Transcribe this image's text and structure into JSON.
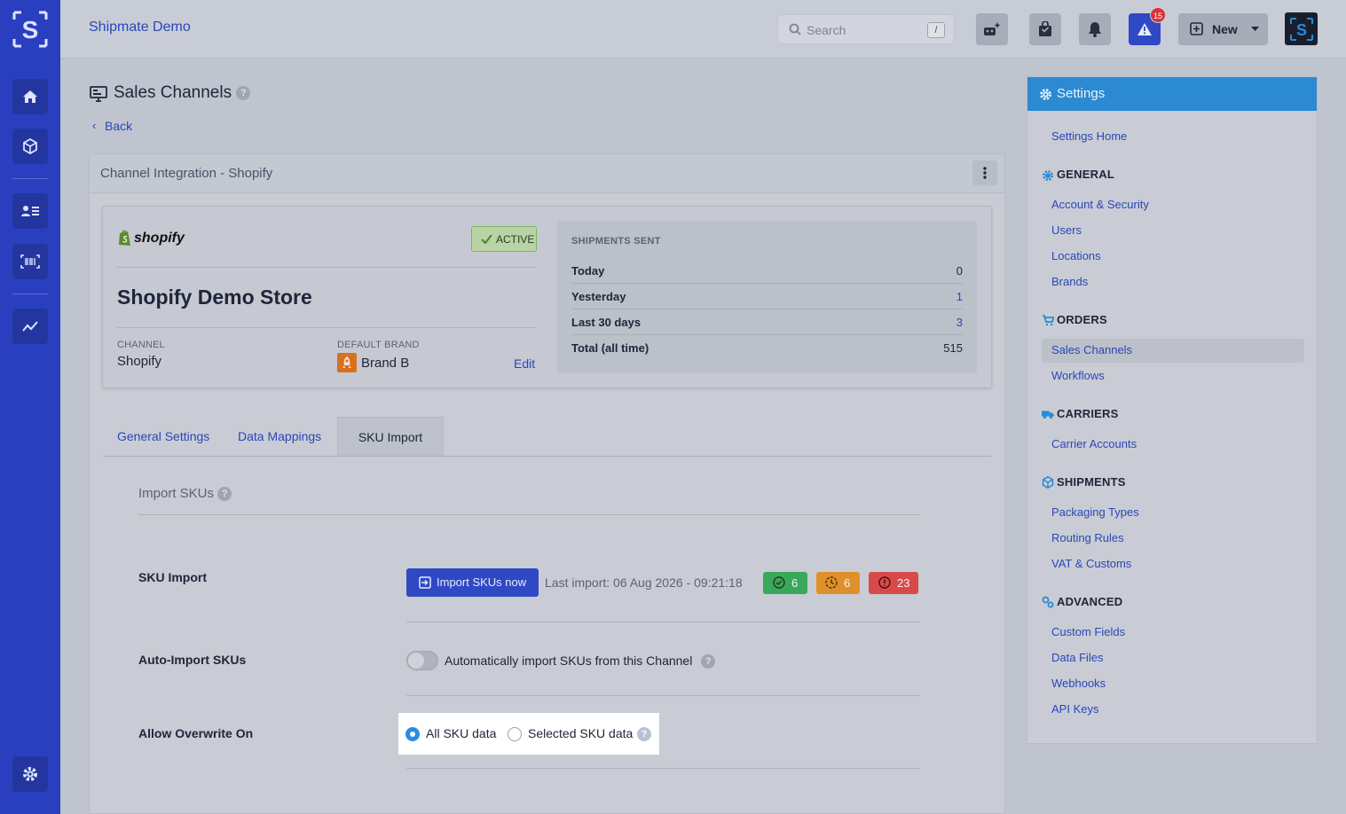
{
  "header": {
    "app_name": "Shipmate Demo",
    "search_placeholder": "Search",
    "search_shortcut": "/",
    "alert_count": "15",
    "new_label": "New"
  },
  "rail": {
    "items": [
      "home",
      "packages",
      "contacts",
      "barcode",
      "analytics",
      "settings"
    ]
  },
  "page": {
    "title": "Sales Channels",
    "back_label": "Back"
  },
  "card": {
    "title": "Channel Integration - Shopify",
    "logo_text": "shopify",
    "status": "ACTIVE",
    "store_name": "Shopify Demo Store",
    "channel_label": "CHANNEL",
    "channel_value": "Shopify",
    "brand_label": "DEFAULT BRAND",
    "brand_value": "Brand B",
    "edit_label": "Edit",
    "stats": {
      "heading": "SHIPMENTS SENT",
      "rows": [
        {
          "label": "Today",
          "value": "0"
        },
        {
          "label": "Yesterday",
          "value": "1"
        },
        {
          "label": "Last 30 days",
          "value": "3"
        },
        {
          "label": "Total (all time)",
          "value": "515"
        }
      ]
    }
  },
  "tabs": [
    {
      "label": "General Settings"
    },
    {
      "label": "Data Mappings"
    },
    {
      "label": "SKU Import"
    }
  ],
  "sku": {
    "section_title": "Import SKUs",
    "import_label": "SKU Import",
    "import_button": "Import SKUs now",
    "last_import": "Last import: 06 Aug 2026 - 09:21:18",
    "counts": {
      "success": "6",
      "pending": "6",
      "error": "23"
    },
    "auto_label": "Auto-Import SKUs",
    "auto_text": "Automatically import SKUs from this Channel",
    "overwrite_label": "Allow Overwrite On",
    "radio_all": "All SKU data",
    "radio_selected": "Selected SKU data"
  },
  "settings": {
    "title": "Settings",
    "home": "Settings Home",
    "groups": {
      "general": {
        "title": "GENERAL",
        "items": [
          "Account & Security",
          "Users",
          "Locations",
          "Brands"
        ]
      },
      "orders": {
        "title": "ORDERS",
        "items": [
          "Sales Channels",
          "Workflows"
        ]
      },
      "carriers": {
        "title": "CARRIERS",
        "items": [
          "Carrier Accounts"
        ]
      },
      "shipments": {
        "title": "SHIPMENTS",
        "items": [
          "Packaging Types",
          "Routing Rules",
          "VAT & Customs"
        ]
      },
      "advanced": {
        "title": "ADVANCED",
        "items": [
          "Custom Fields",
          "Data Files",
          "Webhooks",
          "API Keys"
        ]
      }
    }
  },
  "colors": {
    "rail": "#2a3fc0",
    "accent": "#2f48c4",
    "settings_header": "#2b8ad2",
    "success": "#3aa85a",
    "warning": "#e0902a",
    "error": "#d84a4a"
  }
}
